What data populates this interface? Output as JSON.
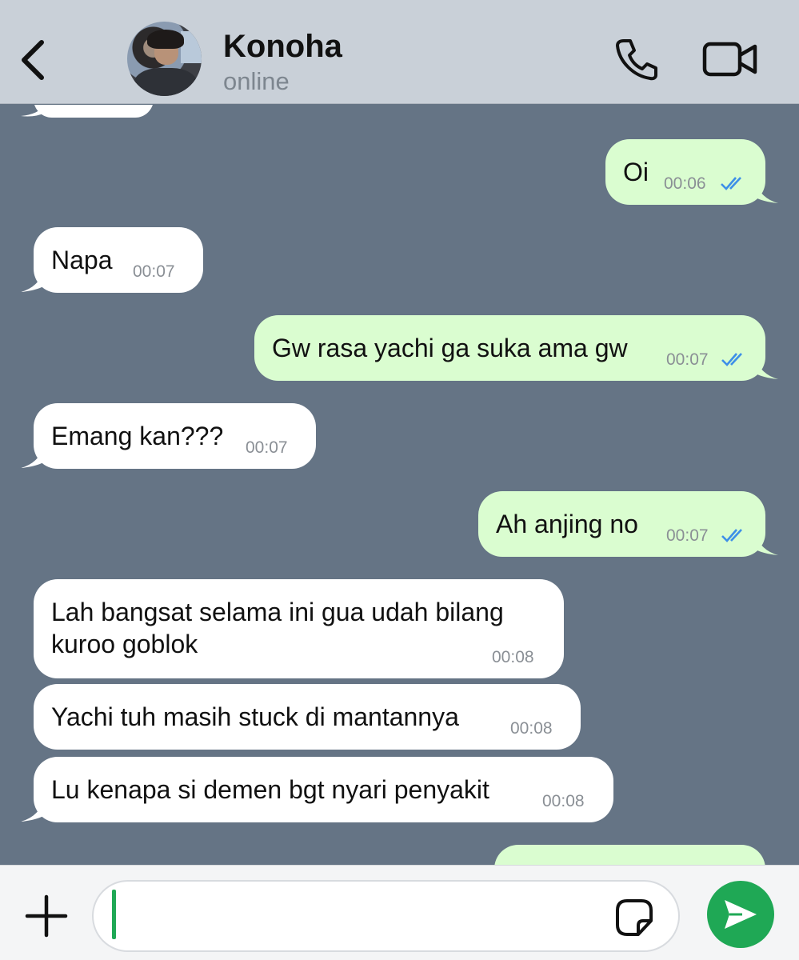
{
  "header": {
    "contact_name": "Konoha",
    "status": "online",
    "back_icon": "chevron-left-icon",
    "call_icon": "phone-icon",
    "video_icon": "video-camera-icon"
  },
  "messages": [
    {
      "direction": "outgoing",
      "text": "Oi",
      "time": "00:06",
      "read": true
    },
    {
      "direction": "incoming",
      "text": "Napa",
      "time": "00:07"
    },
    {
      "direction": "outgoing",
      "text": "Gw rasa yachi ga suka ama gw",
      "time": "00:07",
      "read": true
    },
    {
      "direction": "incoming",
      "text": "Emang kan???",
      "time": "00:07"
    },
    {
      "direction": "outgoing",
      "text": "Ah anjing no",
      "time": "00:07",
      "read": true
    },
    {
      "direction": "incoming",
      "lines": [
        "Lah bangsat selama ini gua udah bilang",
        "kuroo goblok"
      ],
      "time": "00:08"
    },
    {
      "direction": "incoming",
      "text": "Yachi tuh masih stuck di mantannya",
      "time": "00:08"
    },
    {
      "direction": "incoming",
      "text": "Lu kenapa si demen bgt nyari penyakit",
      "time": "00:08"
    }
  ],
  "input": {
    "value": "",
    "plus_icon": "plus-icon",
    "sticker_icon": "sticker-icon",
    "send_icon": "send-icon"
  },
  "colors": {
    "chat_background": "#657485",
    "outgoing_bubble": "#dafdd0",
    "incoming_bubble": "#ffffff",
    "read_ticks": "#3d8fe8",
    "accent": "#1fa855"
  }
}
